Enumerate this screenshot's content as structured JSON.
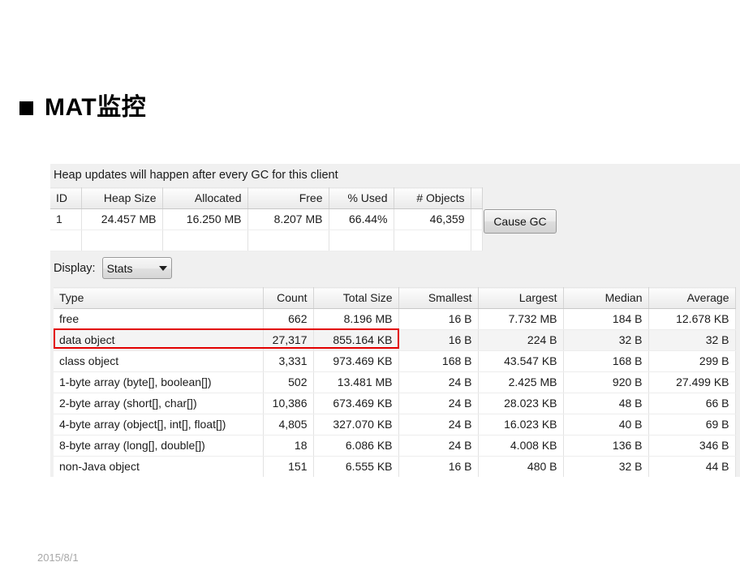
{
  "slide": {
    "title": "MAT监控",
    "bullet_icon": "filled-square-bullet-icon",
    "footer_date": "2015/8/1"
  },
  "panel": {
    "heap_note": "Heap updates will happen after every GC for this client",
    "cause_gc_label": "Cause GC",
    "display_label": "Display:",
    "display_value": "Stats",
    "display_caret_icon": "chevron-down-icon"
  },
  "heap_table": {
    "columns": [
      "ID",
      "Heap Size",
      "Allocated",
      "Free",
      "% Used",
      "# Objects",
      ""
    ],
    "rows": [
      {
        "id": "1",
        "heap_size": "24.457 MB",
        "allocated": "16.250 MB",
        "free": "8.207 MB",
        "percent_used": "66.44%",
        "objects": "46,359",
        "blank": ""
      }
    ]
  },
  "stats_table": {
    "columns": [
      "Type",
      "Count",
      "Total Size",
      "Smallest",
      "Largest",
      "Median",
      "Average"
    ],
    "rows": [
      {
        "type": "free",
        "count": "662",
        "total_size": "8.196 MB",
        "smallest": "16 B",
        "largest": "7.732 MB",
        "median": "184 B",
        "average": "12.678 KB",
        "highlighted": false
      },
      {
        "type": "data object",
        "count": "27,317",
        "total_size": "855.164 KB",
        "smallest": "16 B",
        "largest": "224 B",
        "median": "32 B",
        "average": "32 B",
        "highlighted": true
      },
      {
        "type": "class object",
        "count": "3,331",
        "total_size": "973.469 KB",
        "smallest": "168 B",
        "largest": "43.547 KB",
        "median": "168 B",
        "average": "299 B",
        "highlighted": false
      },
      {
        "type": "1-byte array (byte[], boolean[])",
        "count": "502",
        "total_size": "13.481 MB",
        "smallest": "24 B",
        "largest": "2.425 MB",
        "median": "920 B",
        "average": "27.499 KB",
        "highlighted": false
      },
      {
        "type": "2-byte array (short[], char[])",
        "count": "10,386",
        "total_size": "673.469 KB",
        "smallest": "24 B",
        "largest": "28.023 KB",
        "median": "48 B",
        "average": "66 B",
        "highlighted": false
      },
      {
        "type": "4-byte array (object[], int[], float[])",
        "count": "4,805",
        "total_size": "327.070 KB",
        "smallest": "24 B",
        "largest": "16.023 KB",
        "median": "40 B",
        "average": "69 B",
        "highlighted": false
      },
      {
        "type": "8-byte array (long[], double[])",
        "count": "18",
        "total_size": "6.086 KB",
        "smallest": "24 B",
        "largest": "4.008 KB",
        "median": "136 B",
        "average": "346 B",
        "highlighted": false
      },
      {
        "type": "non-Java object",
        "count": "151",
        "total_size": "6.555 KB",
        "smallest": "16 B",
        "largest": "480 B",
        "median": "32 B",
        "average": "44 B",
        "highlighted": false
      }
    ]
  },
  "colors": {
    "highlight_border": "#e20000",
    "panel_background": "#f0f0f0",
    "text": "#1b1b1b",
    "footer_text": "#a8a8a8"
  }
}
